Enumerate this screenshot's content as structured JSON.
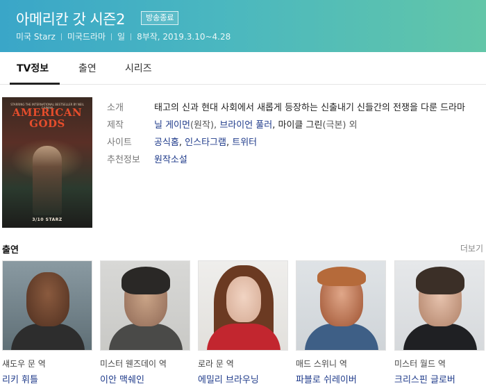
{
  "header": {
    "title": "아메리칸 갓 시즌2",
    "badge": "방송종료",
    "meta": [
      "미국 Starz",
      "미국드라마",
      "일",
      "8부작, 2019.3.10~4.28"
    ],
    "bg_colors": [
      "#3aa6c8",
      "#62c6a8"
    ]
  },
  "tabs": [
    {
      "label": "TV정보",
      "active": true
    },
    {
      "label": "출연",
      "active": false
    },
    {
      "label": "시리즈",
      "active": false
    }
  ],
  "poster": {
    "top_text": "STARRING THE INTERNATIONAL BESTSELLER BY NEIL GAIMAN",
    "title_line1": "AMERICAN",
    "title_line2": "GODS",
    "caption": "3/10 STARZ"
  },
  "info": {
    "intro_label": "소개",
    "intro_text": "태고의 신과 현대 사회에서 새롭게 등장하는 신출내기 신들간의 전쟁을 다룬 드라마",
    "production_label": "제작",
    "production": {
      "name1": "닐 게이먼",
      "role1": "(원작), ",
      "name2": "브라이언 풀러",
      "sep": ", ",
      "name3": "마이클 그린",
      "role3": "(극본) 외"
    },
    "site_label": "사이트",
    "sites": {
      "s1": "공식홈",
      "s2": "인스타그램",
      "s3": "트위터",
      "sep": ", "
    },
    "recommend_label": "추천정보",
    "recommend": "원작소설"
  },
  "cast": {
    "title": "출연",
    "more": "더보기",
    "members": [
      {
        "role": "섀도우 문 역",
        "name": "리키 휘틀"
      },
      {
        "role": "미스터 웬즈데이 역",
        "name": "이안 맥쉐인"
      },
      {
        "role": "로라 문 역",
        "name": "에밀리 브라우닝"
      },
      {
        "role": "매드 스위니 역",
        "name": "파블로 쉬레이버"
      },
      {
        "role": "미스터 월드 역",
        "name": "크리스핀 글로버"
      }
    ]
  }
}
